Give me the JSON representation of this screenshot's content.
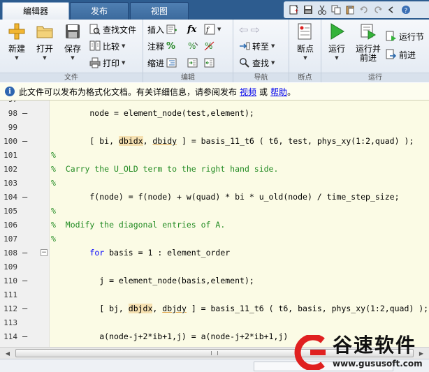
{
  "tabs": [
    {
      "label": "编辑器",
      "active": true
    },
    {
      "label": "发布",
      "active": false
    },
    {
      "label": "视图",
      "active": false
    }
  ],
  "quick_access": [
    "new-icon",
    "save-icon",
    "cut-icon",
    "copy-icon",
    "paste-icon",
    "undo-icon",
    "redo-icon",
    "back-icon",
    "help-icon"
  ],
  "ribbon": {
    "file": {
      "label": "文件",
      "new": "新建",
      "open": "打开",
      "save": "保存",
      "find_files": "查找文件",
      "compare": "比较",
      "print": "打印"
    },
    "edit": {
      "label": "编辑",
      "insert": "插入",
      "comment": "注释",
      "indent": "缩进",
      "fx": "fx"
    },
    "navigate": {
      "label": "导航",
      "goto": "转至",
      "find": "查找"
    },
    "breakpoints": {
      "label": "断点",
      "breakpoints": "断点"
    },
    "run": {
      "label": "运行",
      "run": "运行",
      "run_and_advance_1": "运行并",
      "run_and_advance_2": "前进",
      "run_section": "运行节",
      "advance": "前进"
    }
  },
  "info_bar": {
    "message": "此文件可以发布为格式化文档。有关详细信息，请参阅发布",
    "link1": "视频",
    "connector": "或",
    "link2": "帮助",
    "period": "。"
  },
  "editor": {
    "first_line_number": "97",
    "lines": [
      {
        "num": "98",
        "dash": "–",
        "kind": "code",
        "text": "        node = element_node(test,element);"
      },
      {
        "num": "99",
        "dash": "",
        "kind": "code",
        "text": ""
      },
      {
        "num": "100",
        "dash": "–",
        "kind": "code",
        "text": "        [ bi, dbidx, dbidy ] = basis_11_t6 ( t6, test, phys_xy(1:2,quad) );"
      },
      {
        "num": "101",
        "dash": "",
        "kind": "comment",
        "text": "%"
      },
      {
        "num": "102",
        "dash": "",
        "kind": "comment",
        "text": "%  Carry the U_OLD term to the right hand side."
      },
      {
        "num": "103",
        "dash": "",
        "kind": "comment",
        "text": "%"
      },
      {
        "num": "104",
        "dash": "–",
        "kind": "code",
        "text": "        f(node) = f(node) + w(quad) * bi * u_old(node) / time_step_size;"
      },
      {
        "num": "105",
        "dash": "",
        "kind": "comment",
        "text": "%"
      },
      {
        "num": "106",
        "dash": "",
        "kind": "comment",
        "text": "%  Modify the diagonal entries of A."
      },
      {
        "num": "107",
        "dash": "",
        "kind": "comment",
        "text": "%"
      },
      {
        "num": "108",
        "dash": "–",
        "kind": "code",
        "text": "        for basis = 1 : element_order"
      },
      {
        "num": "109",
        "dash": "",
        "kind": "code",
        "text": ""
      },
      {
        "num": "110",
        "dash": "–",
        "kind": "code",
        "text": "          j = element_node(basis,element);"
      },
      {
        "num": "111",
        "dash": "",
        "kind": "code",
        "text": ""
      },
      {
        "num": "112",
        "dash": "–",
        "kind": "code",
        "text": "          [ bj, dbjdx, dbjdy ] = basis_11_t6 ( t6, basis, phys_xy(1:2,quad) );"
      },
      {
        "num": "113",
        "dash": "",
        "kind": "code",
        "text": ""
      },
      {
        "num": "114",
        "dash": "–",
        "kind": "code",
        "text": "          a(node-j+2*ib+1,j) = a(node-j+2*ib+1,j)"
      }
    ]
  },
  "watermark": {
    "title": "谷速软件",
    "url": "www.gususoft.com"
  },
  "colors": {
    "tabbar": "#2d5c8f",
    "comment": "#228b22",
    "keyword": "#0000ff",
    "cell_highlight": "#fbfbe5",
    "watermark_red": "#e02020"
  }
}
